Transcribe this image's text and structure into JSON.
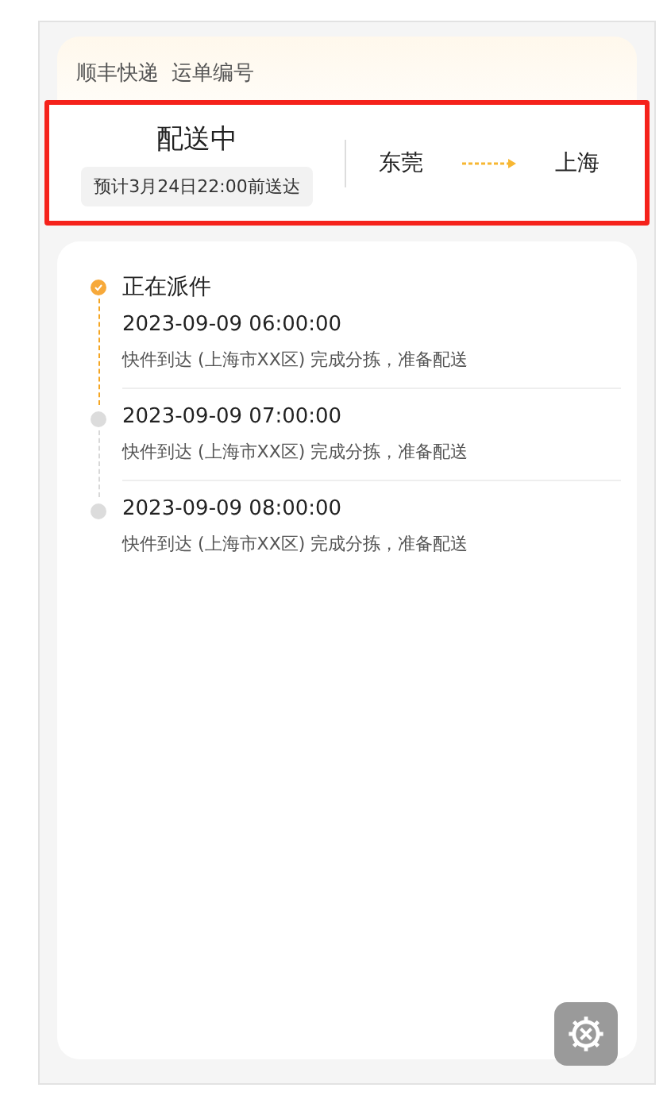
{
  "header": {
    "company": "顺丰快递",
    "waybill_label": "运单编号"
  },
  "status": {
    "title": "配送中",
    "eta": "预计3月24日22:00前送达",
    "from": "东莞",
    "to": "上海",
    "highlighted": true
  },
  "tracks": [
    {
      "title": "正在派件",
      "time": "2023-09-09 06:00:00",
      "detail": "快件到达 (上海市XX区) 完成分拣，准备配送",
      "active": true
    },
    {
      "time": "2023-09-09 07:00:00",
      "detail": "快件到达 (上海市XX区) 完成分拣，准备配送",
      "active": false
    },
    {
      "time": "2023-09-09 08:00:00",
      "detail": "快件到达 (上海市XX区) 完成分拣，准备配送",
      "active": false
    }
  ]
}
